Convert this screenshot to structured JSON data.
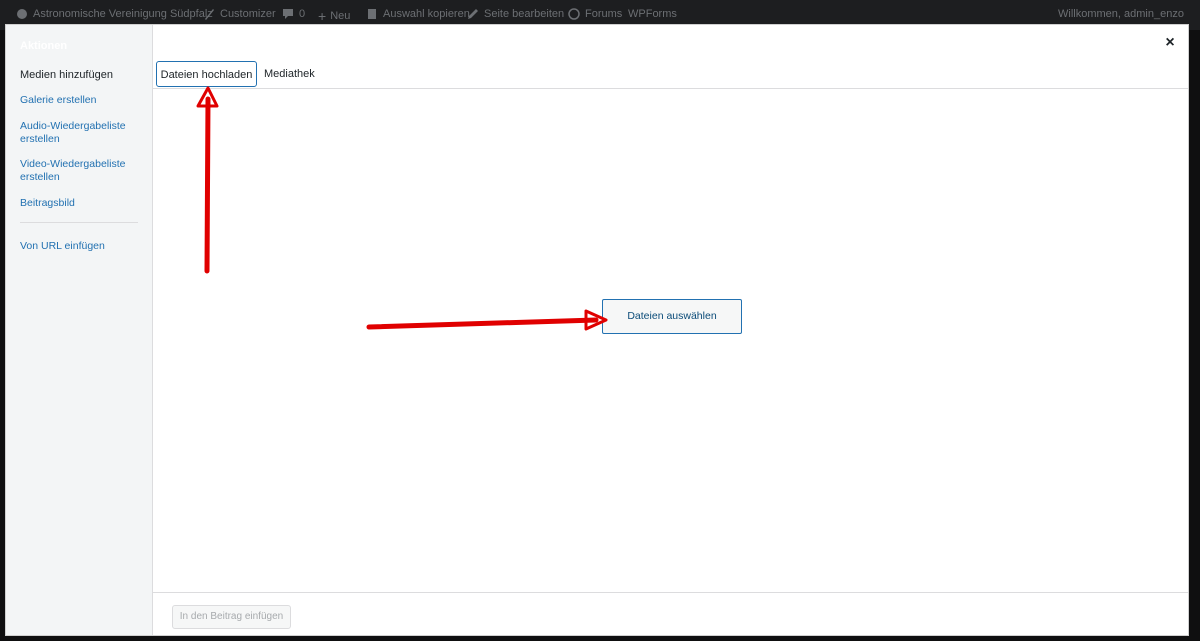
{
  "admin_bar": {
    "site_name": "Astronomische Vereinigung Südpfalz",
    "customizer": "Customizer",
    "comments_count": "0",
    "new": "Neu",
    "copy_selection": "Auswahl kopieren",
    "edit_page": "Seite bearbeiten",
    "forums": "Forums",
    "wpforms": "WPForms",
    "welcome": "Willkommen, admin_enzo"
  },
  "modal": {
    "sidebar_heading": "Aktionen",
    "sidebar_items": [
      {
        "label": "Medien hinzufügen"
      },
      {
        "label": "Galerie erstellen"
      },
      {
        "label": "Audio-Wiedergabeliste erstellen"
      },
      {
        "label": "Video-Wiedergabeliste erstellen"
      },
      {
        "label": "Beitragsbild"
      },
      {
        "label": "Von URL einfügen"
      }
    ],
    "close_glyph": "×",
    "tabs": [
      {
        "label": "Dateien hochladen"
      },
      {
        "label": "Mediathek"
      }
    ],
    "select_files_label": "Dateien auswählen",
    "insert_button_label": "In den Beitrag einfügen"
  },
  "colors": {
    "accent": "#2271b1",
    "annotation_arrow": "#e00000"
  }
}
